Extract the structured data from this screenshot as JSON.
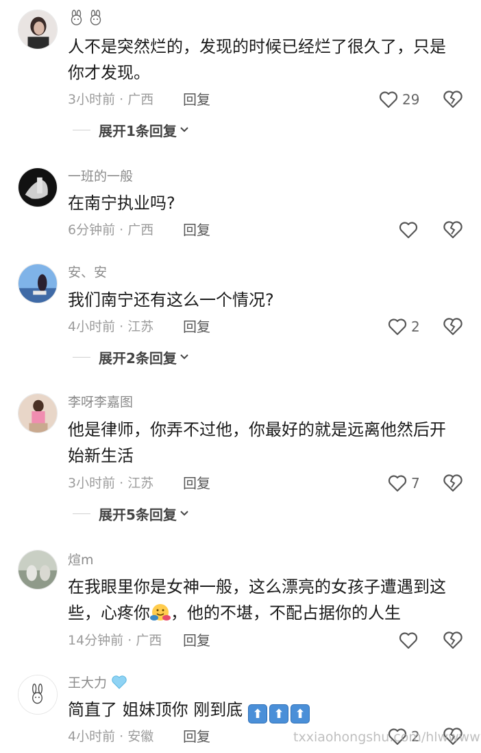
{
  "comments": [
    {
      "user": "🐰🐰",
      "text": "人不是突然烂的，发现的时候已经烂了很久了，只是你才发现。",
      "time_loc": "3小时前 · 广西",
      "reply_label": "回复",
      "likes": "29",
      "expand": "展开1条回复"
    },
    {
      "user": "一班的一般",
      "text": "在南宁执业吗?",
      "time_loc": "6分钟前 · 广西",
      "reply_label": "回复",
      "likes": ""
    },
    {
      "user": "安、安",
      "text": "我们南宁还有这么一个情况?",
      "time_loc": "4小时前 · 江苏",
      "reply_label": "回复",
      "likes": "2",
      "expand": "展开2条回复"
    },
    {
      "user": "李呀李嘉图",
      "text": "他是律师，你弄不过他，你最好的就是远离他然后开始新生活",
      "time_loc": "3小时前 · 江苏",
      "reply_label": "回复",
      "likes": "7",
      "expand": "展开5条回复"
    },
    {
      "user": "煊m",
      "text_part1": "在我眼里你是女神一般，这么漂亮的女孩子遭遇到这些，心疼你",
      "text_part2": "，他的不堪，不配占据你的人生",
      "time_loc": "14分钟前 · 广西",
      "reply_label": "回复",
      "likes": ""
    },
    {
      "user": "王大力",
      "text": "简直了 姐妹顶你 刚到底",
      "time_loc": "4小时前 · 安徽",
      "reply_label": "回复",
      "likes": "2"
    }
  ],
  "icons": {
    "like": "heart-outline-icon",
    "dislike": "broken-heart-icon",
    "expand": "chevron-down-icon",
    "rabbit": "rabbit-face-icon",
    "heart": "light-blue-heart-icon",
    "up_arrow": "up-arrow-icon",
    "hug": "hug-emoji-icon"
  },
  "arrow_glyph": "⬆",
  "watermark": "txxiaohongshu.com/hlwwwww",
  "colors": {
    "text": "#1a1a1a",
    "muted": "#9b9b9b",
    "username": "#8a8a8a",
    "arrow_blue": "#4a8fd8"
  }
}
